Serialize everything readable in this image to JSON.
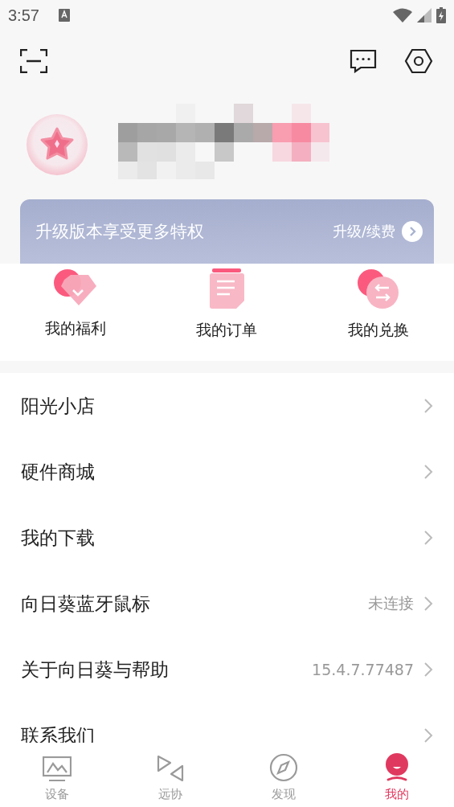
{
  "status_bar": {
    "time": "3:57"
  },
  "banner": {
    "text": "升级版本享受更多特权",
    "action": "升级/续费"
  },
  "shortcuts": [
    {
      "label": "我的福利",
      "kind": "gift"
    },
    {
      "label": "我的订单",
      "kind": "order"
    },
    {
      "label": "我的兑换",
      "kind": "exchange"
    }
  ],
  "menu": [
    {
      "label": "阳光小店"
    },
    {
      "label": "硬件商城"
    },
    {
      "label": "我的下载"
    },
    {
      "label": "向日葵蓝牙鼠标",
      "value": "未连接"
    },
    {
      "label": "关于向日葵与帮助",
      "value": "15.4.7.77487"
    },
    {
      "label": "联系我们"
    }
  ],
  "bottom_nav": [
    {
      "label": "设备",
      "kind": "device",
      "selected": false
    },
    {
      "label": "远协",
      "kind": "assist",
      "selected": false
    },
    {
      "label": "发现",
      "kind": "discover",
      "selected": false
    },
    {
      "label": "我的",
      "kind": "me",
      "selected": true
    }
  ]
}
